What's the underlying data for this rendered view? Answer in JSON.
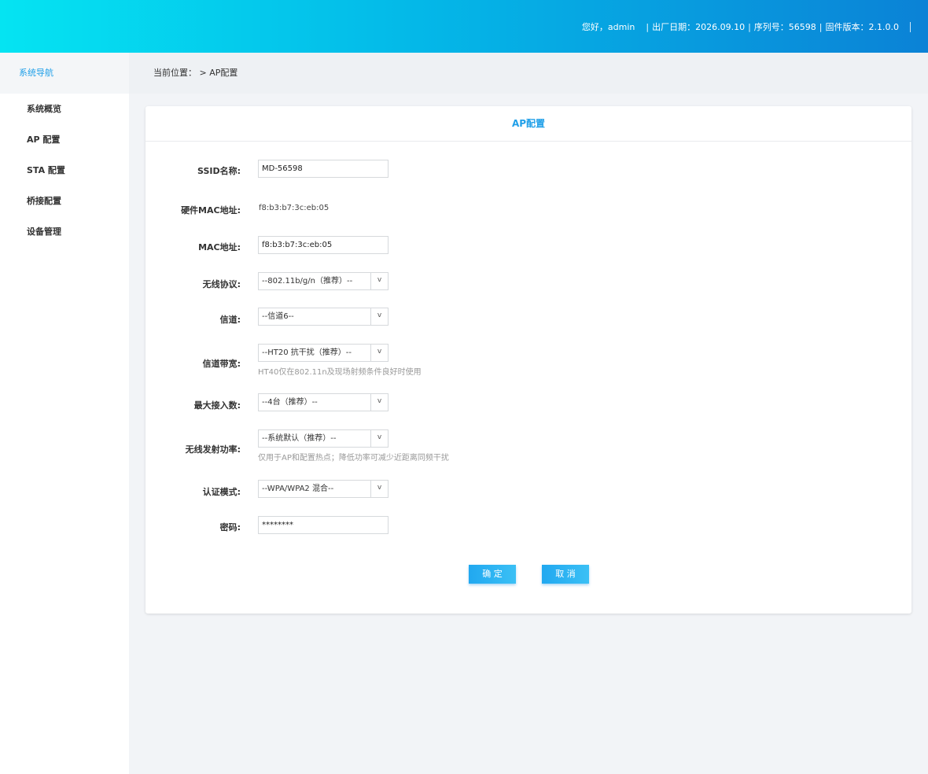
{
  "header": {
    "greeting": "您好，admin",
    "factory_date": "出厂日期：2026.09.10",
    "serial": "序列号：56598",
    "firmware": "固件版本：2.1.0.0",
    "separator": "|"
  },
  "sidebar": {
    "title": "系统导航",
    "items": [
      {
        "label": "系统概览"
      },
      {
        "label": "AP 配置"
      },
      {
        "label": "STA 配置"
      },
      {
        "label": "桥接配置"
      },
      {
        "label": "设备管理"
      }
    ]
  },
  "breadcrumb": {
    "text": "当前位置：  > AP配置"
  },
  "panel": {
    "title": "AP配置"
  },
  "form": {
    "ssid": {
      "label": "SSID名称:",
      "value": "MD-56598"
    },
    "hw_mac": {
      "label": "硬件MAC地址:",
      "value": "f8:b3:b7:3c:eb:05"
    },
    "mac": {
      "label": "MAC地址:",
      "value": "f8:b3:b7:3c:eb:05"
    },
    "protocol": {
      "label": "无线协议:",
      "value": "--802.11b/g/n（推荐）--",
      "arrow": "v"
    },
    "channel": {
      "label": "信道:",
      "value": "--信道6--",
      "arrow": "v"
    },
    "bandwidth": {
      "label": "信道带宽:",
      "value": "--HT20 抗干扰（推荐）--",
      "arrow": "v",
      "hint": "HT40仅在802.11n及现场射频条件良好时使用"
    },
    "max_clients": {
      "label": "最大接入数:",
      "value": "--4台（推荐）--",
      "arrow": "v"
    },
    "tx_power": {
      "label": "无线发射功率:",
      "value": "--系统默认（推荐）--",
      "arrow": "v",
      "hint": "仅用于AP和配置热点；降低功率可减少近距离同频干扰"
    },
    "auth": {
      "label": "认证模式:",
      "value": "--WPA/WPA2 混合--",
      "arrow": "v"
    },
    "password": {
      "label": "密码:",
      "value": "********"
    }
  },
  "buttons": {
    "confirm": "确 定",
    "cancel": "取 消"
  }
}
